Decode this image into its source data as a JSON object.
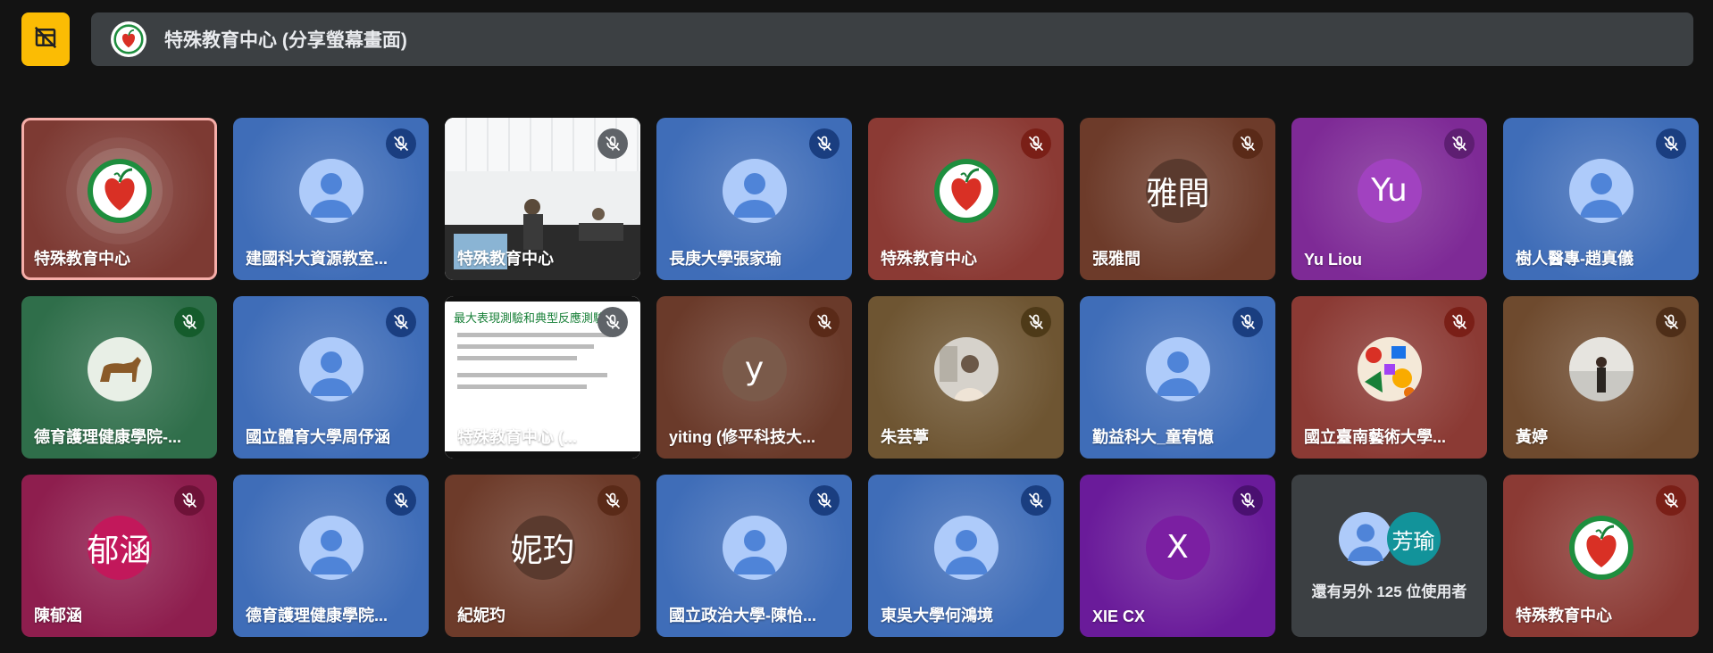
{
  "header": {
    "toggle_icon": "layout-off-icon",
    "presenter_text": "特殊教育中心 (分享螢幕畫面)"
  },
  "tiles": [
    {
      "name": "特殊教育中心",
      "avatar_type": "logo",
      "bg": "#7d3a33",
      "speaking": true,
      "muted": false
    },
    {
      "name": "建國科大資源教室...",
      "avatar_type": "person",
      "bg": "#3f6db8",
      "mute_bg": "#1a3e80"
    },
    {
      "name": "特殊教育中心",
      "avatar_type": "photo",
      "bg": "#e9ecef",
      "mute_bg": "#5f6368"
    },
    {
      "name": "長庚大學張家瑜",
      "avatar_type": "person",
      "bg": "#3f6db8",
      "mute_bg": "#1a3e80"
    },
    {
      "name": "特殊教育中心",
      "avatar_type": "logo",
      "bg": "#8b3a34",
      "mute_bg": "#7a1f17"
    },
    {
      "name": "張雅間",
      "avatar_type": "text",
      "avatar_text": "雅間",
      "avatar_color": "#5a3a2e",
      "bg": "#6d3b2a",
      "mute_bg": "#5a2a18"
    },
    {
      "name": "Yu Liou",
      "avatar_type": "text",
      "avatar_text": "Yu",
      "avatar_color": "#a142c0",
      "bg": "#7e2a96",
      "mute_bg": "#5e1e72"
    },
    {
      "name": "樹人醫專-趙真儀",
      "avatar_type": "person",
      "bg": "#3f6db8",
      "mute_bg": "#1a3e80"
    },
    {
      "name": "德育護理健康學院-...",
      "avatar_type": "dog",
      "bg": "#2f6e4a",
      "mute_bg": "#155c2c"
    },
    {
      "name": "國立體育大學周伃涵",
      "avatar_type": "person",
      "bg": "#3f6db8",
      "mute_bg": "#1a3e80"
    },
    {
      "name": "特殊教育中心 (...",
      "avatar_type": "slide",
      "bg": "#ffffff",
      "mute_bg": "#5f6368",
      "slide_title": "最大表現測驗和典型反應測驗"
    },
    {
      "name": "yiting (修平科技大...",
      "avatar_type": "text",
      "avatar_text": "y",
      "avatar_color": "#7a5a4a",
      "bg": "#6a3a2a",
      "mute_bg": "#5a2a18"
    },
    {
      "name": "朱芸葶",
      "avatar_type": "photo-round",
      "bg": "#6e5532",
      "mute_bg": "#4e3a18"
    },
    {
      "name": "勤益科大_童宥憶",
      "avatar_type": "person",
      "bg": "#3f6db8",
      "mute_bg": "#1a3e80"
    },
    {
      "name": "國立臺南藝術大學...",
      "avatar_type": "mosaic",
      "bg": "#8b3a34",
      "mute_bg": "#7a1f17"
    },
    {
      "name": "黃婷",
      "avatar_type": "photo-round2",
      "bg": "#6e4a2e",
      "mute_bg": "#4e2e18"
    },
    {
      "name": "陳郁涵",
      "avatar_type": "text",
      "avatar_text": "郁涵",
      "avatar_color": "#c2185b",
      "bg": "#8e1e4e",
      "mute_bg": "#6e1238"
    },
    {
      "name": "德育護理健康學院...",
      "avatar_type": "person",
      "bg": "#3f6db8",
      "mute_bg": "#1a3e80"
    },
    {
      "name": "紀妮玓",
      "avatar_type": "text",
      "avatar_text": "妮玓",
      "avatar_color": "#5a3a2e",
      "bg": "#6d3b2a",
      "mute_bg": "#5a2a18"
    },
    {
      "name": "國立政治大學-陳怡...",
      "avatar_type": "person",
      "bg": "#3f6db8",
      "mute_bg": "#1a3e80"
    },
    {
      "name": "東吳大學何鴻境",
      "avatar_type": "person",
      "bg": "#3f6db8",
      "mute_bg": "#1a3e80"
    },
    {
      "name": "XIE CX",
      "avatar_type": "text",
      "avatar_text": "X",
      "avatar_color": "#7b1fa2",
      "bg": "#6a1b9a",
      "mute_bg": "#4a1070"
    },
    {
      "type": "more",
      "more_text": "還有另外 125 位使用者",
      "more_avatar_text": "芳瑜"
    },
    {
      "name": "特殊教育中心",
      "avatar_type": "logo",
      "bg": "#8b3a34",
      "mute_bg": "#7a1f17"
    }
  ]
}
